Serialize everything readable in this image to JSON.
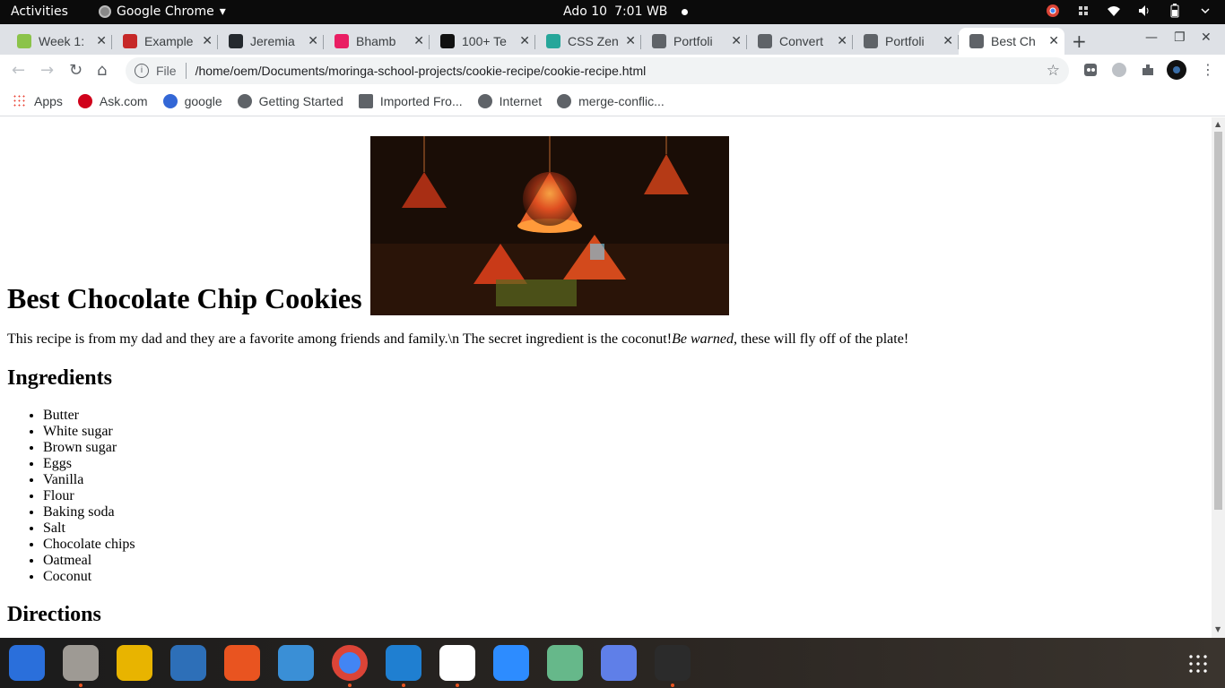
{
  "topbar": {
    "activities": "Activities",
    "app_name": "Google Chrome",
    "app_menu_arrow": "▾",
    "date": "Ado 10",
    "time": "7:01 WB"
  },
  "tabs": [
    {
      "label": "Week 1:",
      "active": false,
      "fav_color": "#8bc34a"
    },
    {
      "label": "Example",
      "active": false,
      "fav_color": "#c62828"
    },
    {
      "label": "Jeremia",
      "active": false,
      "fav_color": "#24292e"
    },
    {
      "label": "Bhamb",
      "active": false,
      "fav_color": "#e91e63"
    },
    {
      "label": "100+ Te",
      "active": false,
      "fav_color": "#111111"
    },
    {
      "label": "CSS Zen",
      "active": false,
      "fav_color": "#26a69a"
    },
    {
      "label": "Portfoli",
      "active": false,
      "fav_color": "#5f6368"
    },
    {
      "label": "Convert",
      "active": false,
      "fav_color": "#5f6368"
    },
    {
      "label": "Portfoli",
      "active": false,
      "fav_color": "#5f6368"
    },
    {
      "label": "Best Ch",
      "active": true,
      "fav_color": "#5f6368"
    }
  ],
  "tab_close": "✕",
  "new_tab": "+",
  "window_controls": {
    "minimize": "—",
    "restore": "❐",
    "close": "✕"
  },
  "toolbar": {
    "back": "←",
    "forward": "→",
    "reload": "↻",
    "home": "⌂",
    "info_symbol": "i",
    "scheme_label": "File",
    "url": "/home/oem/Documents/moringa-school-projects/cookie-recipe/cookie-recipe.html",
    "star": "☆"
  },
  "bookmarks": [
    {
      "label": "Apps",
      "icon": "apps-grid-icon"
    },
    {
      "label": "Ask.com",
      "icon": "ask-icon"
    },
    {
      "label": "google",
      "icon": "google-icon"
    },
    {
      "label": "Getting Started",
      "icon": "globe-icon"
    },
    {
      "label": "Imported Fro...",
      "icon": "folder-icon"
    },
    {
      "label": "Internet",
      "icon": "globe-icon"
    },
    {
      "label": "merge-conflic...",
      "icon": "globe-icon"
    }
  ],
  "page": {
    "heading": "Best Chocolate Chip Cookies",
    "intro_text": "This recipe is from my dad and they are a favorite among friends and family.\\n The secret ingredient is the coconut!",
    "intro_em": "Be warned",
    "intro_tail": ", these will fly off of the plate!",
    "ingredients_heading": "Ingredients",
    "ingredients": [
      "Butter",
      "White sugar",
      "Brown sugar",
      "Eggs",
      "Vanilla",
      "Flour",
      "Baking soda",
      "Salt",
      "Chocolate chips",
      "Oatmeal",
      "Coconut"
    ],
    "directions_heading": "Directions"
  },
  "dock": [
    {
      "name": "thunderbird",
      "color": "#2a6fdb",
      "running": false
    },
    {
      "name": "files",
      "color": "#9e9a94",
      "running": true
    },
    {
      "name": "rhythmbox",
      "color": "#e8b400",
      "running": false
    },
    {
      "name": "libreoffice-writer",
      "color": "#2d6fb8",
      "running": false
    },
    {
      "name": "software-center",
      "color": "#e95420",
      "running": false
    },
    {
      "name": "help",
      "color": "#3a8fd6",
      "running": false
    },
    {
      "name": "google-chrome",
      "color": "#db4437",
      "running": true
    },
    {
      "name": "vscode",
      "color": "#1f7fd1",
      "running": true
    },
    {
      "name": "slack",
      "color": "#ffffff",
      "running": true
    },
    {
      "name": "zoom",
      "color": "#2d8cff",
      "running": false
    },
    {
      "name": "atom",
      "color": "#66b88a",
      "running": false
    },
    {
      "name": "screenshot",
      "color": "#5f7fe8",
      "running": false
    },
    {
      "name": "system-monitor",
      "color": "#2b2b2b",
      "running": true
    }
  ]
}
